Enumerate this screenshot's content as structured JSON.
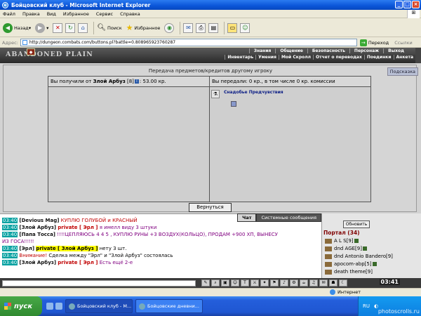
{
  "window": {
    "title": "Бойцовский клуб - Microsoft Internet Explorer",
    "buttons": [
      "_",
      "□",
      "×"
    ]
  },
  "menu": [
    "Файл",
    "Правка",
    "Вид",
    "Избранное",
    "Сервис",
    "Справка"
  ],
  "toolbar": {
    "back": "Назад",
    "search": "Поиск",
    "favorites": "Избранное"
  },
  "address": {
    "label": "Адрес:",
    "url": "http://dungeon.combats.com/buttons.pl?battle=0.808965923760287",
    "go": "Переход",
    "links": "Ссылки"
  },
  "game": {
    "logo": "ABANDONED PLAIN",
    "nav_top": [
      "Знания",
      "Общение",
      "Безопасность",
      "Персонаж",
      "Выход"
    ],
    "nav_bottom": [
      "Инвентарь",
      "Умения",
      "Мой Скролл",
      "Отчет о переводах",
      "Поединки",
      "Анкета"
    ],
    "help": "Подсказка",
    "panel_title": "Передача предметов/кредитов другому игроку",
    "received": {
      "prefix": "Вы получили от",
      "from": "Злой Арбуз",
      "level": "[8]",
      "amount": ": 53.00 кр."
    },
    "gave": {
      "text": "Вы передали: 0 кр., в том числе 0 кр. комиссии",
      "item": "Снадобье Предчувствия"
    },
    "back_button": "Вернуться"
  },
  "chat": {
    "tabs": [
      "Чат",
      "Системные сообщения"
    ],
    "lines": [
      {
        "time": "03:40",
        "nick": "[Devious Mag]",
        "text": "КУПЛЮ ГОЛУБОЙ и КРАСНЫЙ"
      },
      {
        "time": "03:40",
        "nick": "[Злой Арбуз]",
        "private": "private [ Эрл ]",
        "text": "я имелл виду 3 штуки"
      },
      {
        "time": "03:40",
        "nick": "[Папа Тосса]",
        "text": "!!!!ЦЕПЛЯЮСЬ 4 4 5 , КУПЛЮ РУНЫ +3 ВОЗДУХ(КОЛЬЦО), ПРОДАМ +900 ХП, ВЫНЕСУ"
      },
      {
        "text": "ИЗ ГОСА!!!!!"
      },
      {
        "time": "03:40",
        "nick": "[Эрл]",
        "private": "private [ Злой Арбуз ]",
        "text": "нету 3 шт."
      },
      {
        "time": "03:40",
        "alert": "Внимание!",
        "text": "Сделка между \"Эрл\" и \"Злой Арбуз\" состоялась"
      },
      {
        "time": "03:40",
        "nick": "[Злой Арбуз]",
        "private": "private [ Эрл ]",
        "text": "Есть ещё 2-е"
      }
    ]
  },
  "online": {
    "refresh": "Обновить",
    "room": "Портал (34)",
    "players": [
      "A L S[9]",
      "dnd AGE[9]",
      "dnd Antonio Bandero[9]",
      "apocom-abp[5]",
      "death theme[9]"
    ]
  },
  "clock": "03:41",
  "status": {
    "zone": "Интернет"
  },
  "taskbar": {
    "start": "пуск",
    "tasks": [
      "Бойцовский клуб - M...",
      "Бойцовские дневни..."
    ],
    "lang": "RU"
  },
  "watermark": "photoscrolls.ru"
}
